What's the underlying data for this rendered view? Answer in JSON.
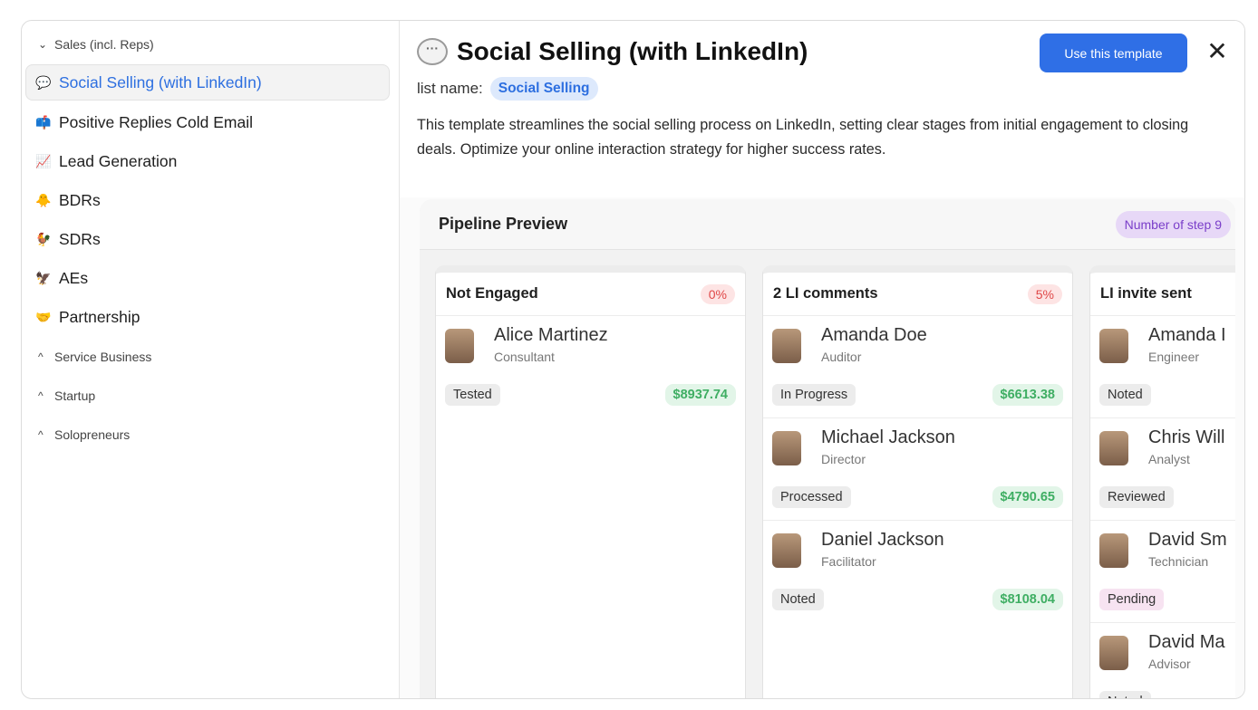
{
  "sidebar": {
    "sections": [
      {
        "label": "Sales (incl. Reps)",
        "chevron": "chevron-down-icon"
      },
      {
        "label": "Service Business",
        "chevron": "chevron-up-icon"
      },
      {
        "label": "Startup",
        "chevron": "chevron-up-icon"
      },
      {
        "label": "Solopreneurs",
        "chevron": "chevron-up-icon"
      }
    ],
    "items": [
      {
        "label": "Social Selling (with LinkedIn)",
        "icon": "speech-bubble-icon",
        "active": true
      },
      {
        "label": "Positive Replies Cold Email",
        "icon": "mailbox-icon"
      },
      {
        "label": "Lead Generation",
        "icon": "chart-up-icon"
      },
      {
        "label": "BDRs",
        "icon": "chick-icon"
      },
      {
        "label": "SDRs",
        "icon": "rooster-icon"
      },
      {
        "label": "AEs",
        "icon": "eagle-icon"
      },
      {
        "label": "Partnership",
        "icon": "handshake-icon"
      }
    ]
  },
  "header": {
    "title": "Social Selling (with LinkedIn)",
    "use_button": "Use this template",
    "close": "✕",
    "list_name_label": "list name:",
    "list_name_value": "Social Selling",
    "description": "This template streamlines the social selling process on LinkedIn, setting clear stages from initial engagement to closing deals. Optimize your online interaction strategy for higher success rates."
  },
  "pipeline": {
    "title": "Pipeline Preview",
    "steps_badge": "Number of step 9",
    "columns": [
      {
        "name": "Not Engaged",
        "pct": "0%",
        "cards": [
          {
            "name": "Alice Martinez",
            "role": "Consultant",
            "status": "Tested",
            "amount": "$8937.74"
          }
        ]
      },
      {
        "name": "2 LI comments",
        "pct": "5%",
        "cards": [
          {
            "name": "Amanda Doe",
            "role": "Auditor",
            "status": "In Progress",
            "amount": "$6613.38"
          },
          {
            "name": "Michael Jackson",
            "role": "Director",
            "status": "Processed",
            "amount": "$4790.65"
          },
          {
            "name": "Daniel Jackson",
            "role": "Facilitator",
            "status": "Noted",
            "amount": "$8108.04"
          }
        ]
      },
      {
        "name": "LI invite sent",
        "pct": "",
        "cards": [
          {
            "name": "Amanda I",
            "role": "Engineer",
            "status": "Noted",
            "amount": ""
          },
          {
            "name": "Chris Will",
            "role": "Analyst",
            "status": "Reviewed",
            "amount": ""
          },
          {
            "name": "David Sm",
            "role": "Technician",
            "status": "Pending",
            "amount": ""
          },
          {
            "name": "David Ma",
            "role": "Advisor",
            "status": "Noted",
            "amount": ""
          }
        ]
      }
    ]
  }
}
